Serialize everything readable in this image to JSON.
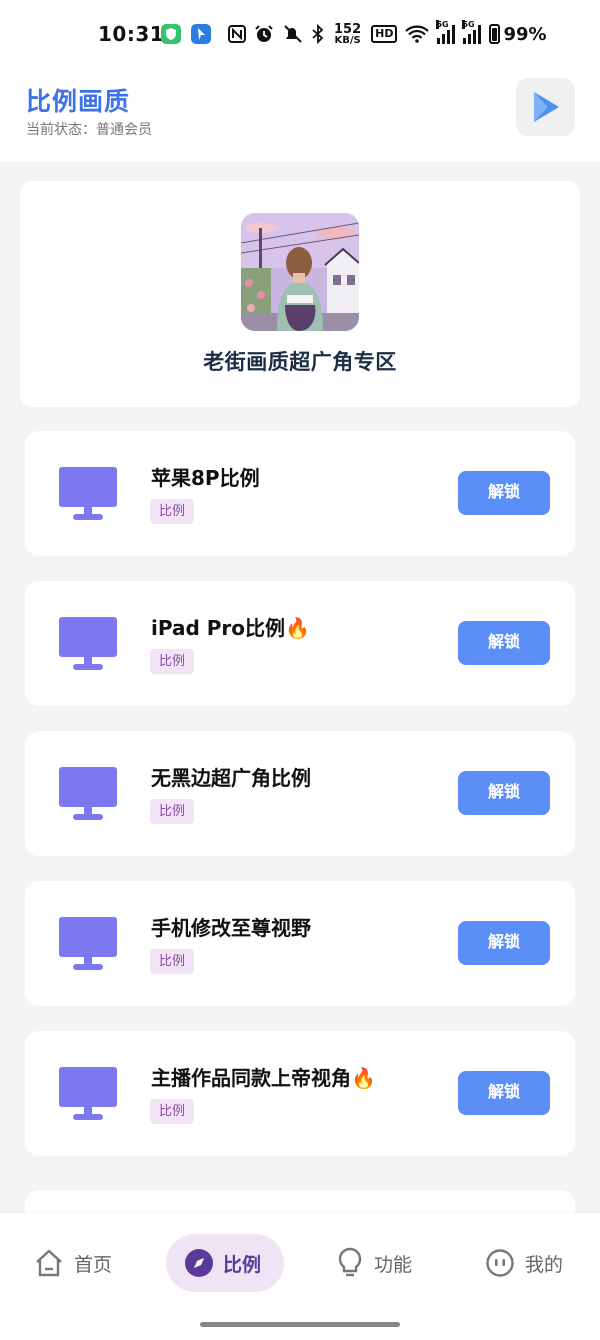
{
  "status_bar": {
    "time": "10:31",
    "net_speed_value": "152",
    "net_speed_unit": "KB/S",
    "hd_label": "HD",
    "sig1_label": "5G",
    "sig2_label": "5G",
    "battery": "99%"
  },
  "header": {
    "title": "比例画质",
    "subtitle": "当前状态：普通会员",
    "action_icon": "play-triangle-icon"
  },
  "banner": {
    "title": "老街画质超广角专区"
  },
  "cards": [
    {
      "title": "苹果8P比例",
      "tag": "比例",
      "button": "解锁",
      "icon": "monitor-icon"
    },
    {
      "title": "iPad Pro比例🔥",
      "tag": "比例",
      "button": "解锁",
      "icon": "monitor-icon"
    },
    {
      "title": "无黑边超广角比例",
      "tag": "比例",
      "button": "解锁",
      "icon": "monitor-icon"
    },
    {
      "title": "手机修改至尊视野",
      "tag": "比例",
      "button": "解锁",
      "icon": "monitor-icon"
    },
    {
      "title": "主播作品同款上帝视角🔥",
      "tag": "比例",
      "button": "解锁",
      "icon": "monitor-icon"
    }
  ],
  "nav": {
    "items": [
      {
        "label": "首页",
        "icon": "home-icon"
      },
      {
        "label": "比例",
        "icon": "compass-icon",
        "active": true
      },
      {
        "label": "功能",
        "icon": "lightbulb-icon"
      },
      {
        "label": "我的",
        "icon": "face-icon"
      }
    ]
  },
  "colors": {
    "accent": "#3d72e8",
    "button": "#5b8ef7",
    "monitor": "#7b78f0",
    "tag_bg": "#f2e4f6",
    "nav_active_bg": "#ede5f6"
  }
}
